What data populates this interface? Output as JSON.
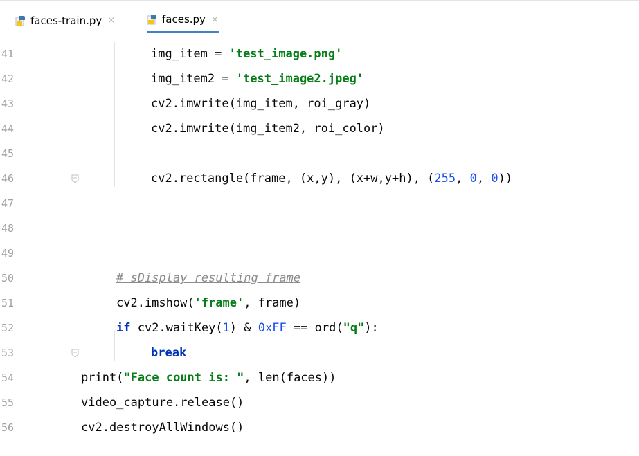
{
  "tabs": [
    {
      "label": "faces-train.py",
      "close": "×",
      "icon": "python-file-icon"
    },
    {
      "label": "faces.py",
      "close": "×",
      "icon": "python-file-icon"
    }
  ],
  "line_numbers": [
    "41",
    "42",
    "43",
    "44",
    "45",
    "46",
    "47",
    "48",
    "49",
    "50",
    "51",
    "52",
    "53",
    "54",
    "55",
    "56"
  ],
  "code": {
    "l41_a": "img_item = ",
    "l41_b": "'test_image.png'",
    "l42_a": "img_item2 = ",
    "l42_b": "'test_image2.jpeg'",
    "l43": "cv2.imwrite(img_item, roi_gray)",
    "l44": "cv2.imwrite(img_item2, roi_color)",
    "l46_a": "cv2.rectangle(frame, (x,y), (x+w,y+h), (",
    "l46_b": "255",
    "l46_c": ", ",
    "l46_d": "0",
    "l46_e": ", ",
    "l46_f": "0",
    "l46_g": "))",
    "l50": "# sDisplay resulting frame",
    "l51_a": "cv2.imshow(",
    "l51_b": "'frame'",
    "l51_c": ", frame)",
    "l52_kw": "if",
    "l52_a": " cv2.waitKey(",
    "l52_b": "1",
    "l52_c": ") & ",
    "l52_d": "0xFF",
    "l52_e": " == ord(",
    "l52_f": "\"q\"",
    "l52_g": "):",
    "l53": "break",
    "l54_a": "print(",
    "l54_b": "\"Face count is: \"",
    "l54_c": ", len(faces))",
    "l55": "video_capture.release()",
    "l56": "cv2.destroyAllWindows()"
  },
  "colors": {
    "string": "#067d17",
    "keyword": "#0033b3",
    "number": "#1750eb",
    "comment": "#8c8c8c",
    "active_tab_underline": "#4083c9"
  }
}
